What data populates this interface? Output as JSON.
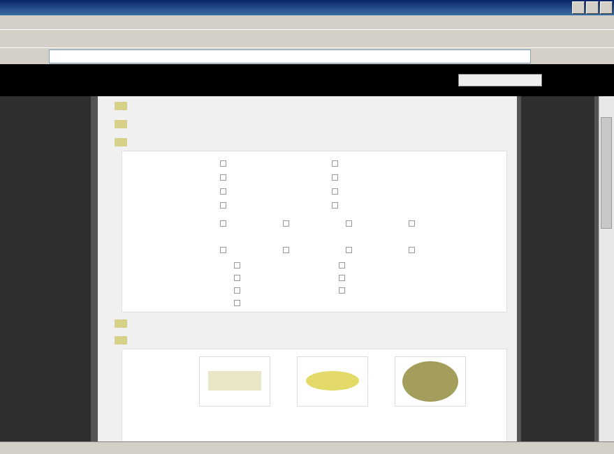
{
  "window": {
    "title": ""
  },
  "menubar": {
    "items": [
      "",
      "",
      "",
      "",
      "",
      ""
    ]
  },
  "toolbar": {
    "items": [
      "",
      "",
      "",
      "",
      "",
      "",
      "",
      "",
      ""
    ]
  },
  "addressbar": {
    "label": "",
    "value": "",
    "go": "",
    "links": ""
  },
  "site": {
    "logo": "",
    "search_label": "",
    "search_value": "",
    "search_button": ""
  },
  "specs_top": [
    {
      "label": "",
      "value": ""
    },
    {
      "label": "",
      "value": ""
    },
    {
      "label": "",
      "value": ""
    }
  ],
  "panel1": {
    "label_a": "",
    "a_col1": [
      "",
      "",
      "",
      ""
    ],
    "a_col2": [
      "",
      "",
      "",
      ""
    ],
    "label_b": "",
    "b_row": [
      "",
      "",
      "",
      ""
    ],
    "b_row2": [
      "",
      "",
      "",
      ""
    ],
    "b_col1": [
      "",
      "",
      "",
      ""
    ],
    "b_col2": [
      "",
      "",
      ""
    ]
  },
  "specs_mid": [
    {
      "label": "",
      "value": ""
    },
    {
      "label": "",
      "value": ""
    }
  ],
  "panel2": {
    "label": "",
    "captions": [
      "",
      "",
      ""
    ]
  },
  "statusbar": {
    "text": "",
    "zone": ""
  },
  "colors": {
    "title_bar": "#0a246a",
    "site_header": "#000000",
    "sidebar": "#2f2f2f",
    "spec_icon": "#d6d08a",
    "swatch_pale": "#e9e7c6",
    "swatch_yellow": "#e3da6a",
    "swatch_olive": "#a39e5c"
  }
}
